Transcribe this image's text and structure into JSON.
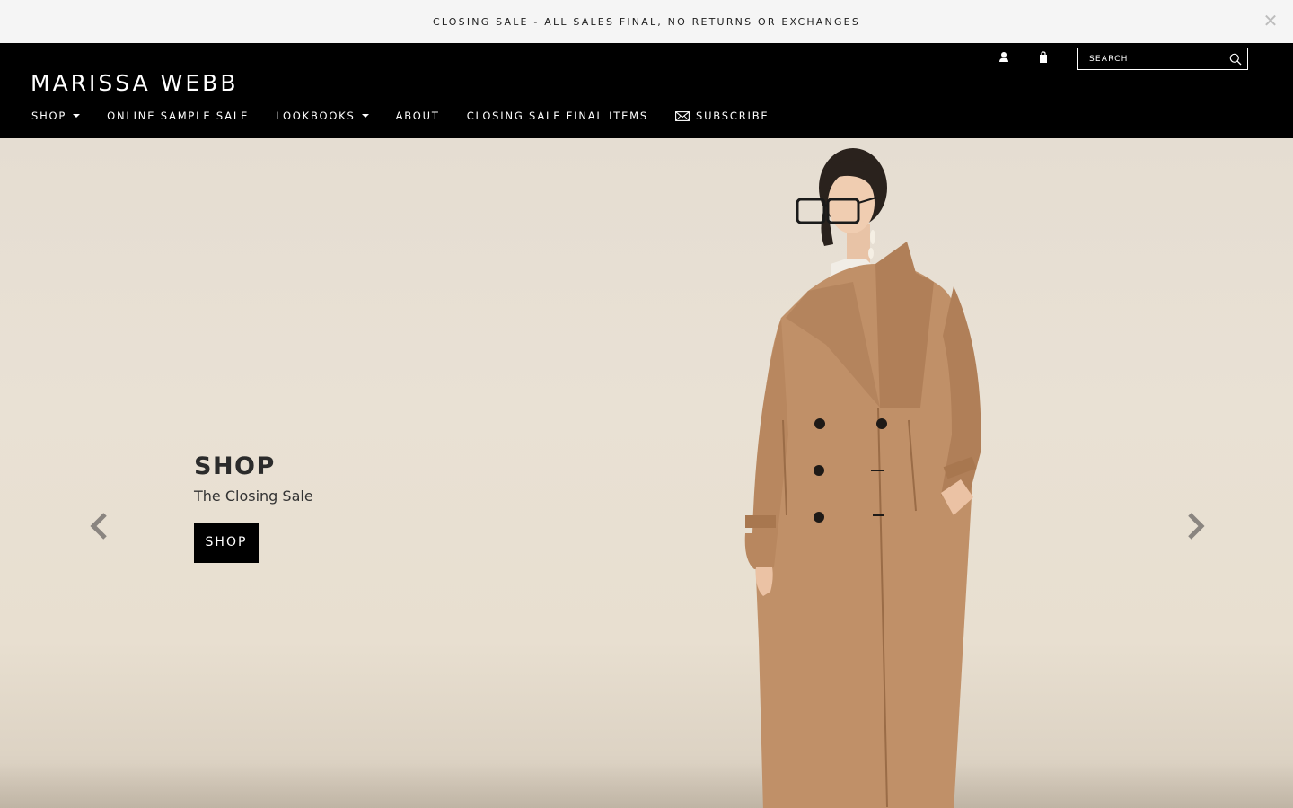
{
  "announcement": {
    "text": "CLOSING SALE - ALL SALES FINAL, NO RETURNS OR EXCHANGES",
    "close_icon": "close-icon"
  },
  "header": {
    "logo": "MARISSA WEBB",
    "account_icon": "user-icon",
    "cart_icon": "shopping-bag-icon",
    "search": {
      "placeholder": "SEARCH",
      "icon": "search-icon"
    }
  },
  "nav": {
    "items": [
      {
        "label": "SHOP",
        "has_dropdown": true
      },
      {
        "label": "ONLINE SAMPLE SALE",
        "has_dropdown": false
      },
      {
        "label": "LOOKBOOKS",
        "has_dropdown": true
      },
      {
        "label": "ABOUT",
        "has_dropdown": false
      },
      {
        "label": "CLOSING SALE FINAL ITEMS",
        "has_dropdown": false
      },
      {
        "label": "SUBSCRIBE",
        "has_dropdown": false,
        "icon": "mail-icon"
      }
    ]
  },
  "hero": {
    "title": "SHOP",
    "subtitle": "The Closing Sale",
    "button_label": "SHOP",
    "prev_icon": "chevron-left-icon",
    "next_icon": "chevron-right-icon"
  },
  "colors": {
    "header_bg": "#000000",
    "announce_bg": "#f5f5f5",
    "hero_bg": "#e8dfd2",
    "coat": "#c09068"
  }
}
